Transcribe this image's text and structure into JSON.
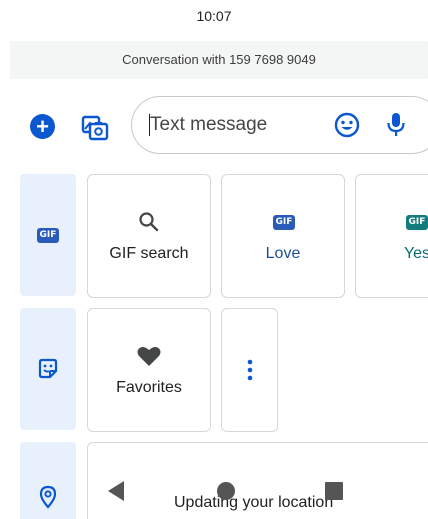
{
  "status_bar": {
    "time": "10:07"
  },
  "banner": {
    "text": "Conversation with 159 7698 9049"
  },
  "compose": {
    "add_icon": "plus-circle-icon",
    "gallery_icon": "photo-gallery-icon",
    "placeholder": "Text message",
    "emoji_icon": "emoji-icon",
    "mic_icon": "microphone-icon"
  },
  "side_tabs": [
    {
      "icon": "gif-icon",
      "badge": "GIF"
    },
    {
      "icon": "sticker-icon"
    },
    {
      "icon": "location-pin-icon"
    }
  ],
  "gif_row": [
    {
      "icon": "search-icon",
      "label": "GIF search"
    },
    {
      "badge": "GIF",
      "label": "Love"
    },
    {
      "badge": "GIF",
      "label": "Yes"
    }
  ],
  "sticker_row": [
    {
      "icon": "heart-icon",
      "label": "Favorites"
    },
    {
      "icon": "more-vert-icon"
    }
  ],
  "location": {
    "text": "Updating your location"
  },
  "nav_bar": {
    "back_icon": "back-triangle-icon",
    "home_icon": "home-circle-icon",
    "recents_icon": "recents-square-icon"
  },
  "colors": {
    "accent": "#0b57d0",
    "tab_bg": "#e8f0fb",
    "love_label": "#1a4f9c",
    "yes_label": "#0b6b73",
    "gif_badge_blue": "#2a5bb8",
    "gif_badge_teal": "#127b7b"
  }
}
